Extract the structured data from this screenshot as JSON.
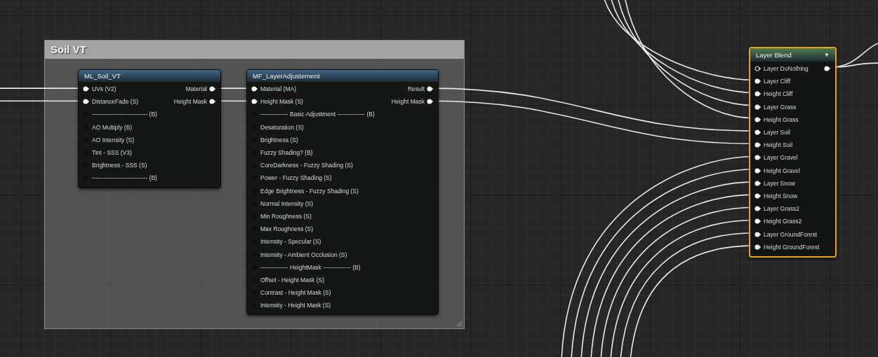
{
  "comment": {
    "title": "Soil VT"
  },
  "nodes": [
    {
      "title": "ML_Soil_VT",
      "color": "#3f6688",
      "selected": false,
      "inputs": [
        {
          "label": "UVs (V2)",
          "connected": true
        },
        {
          "label": "DistanceFade (S)",
          "connected": true
        },
        {
          "label": "---------------------------- (B)",
          "connected": false
        },
        {
          "label": "AO Multiply (B)",
          "connected": false
        },
        {
          "label": "AO Intensity (S)",
          "connected": false
        },
        {
          "label": "Tint - SSS (V3)",
          "connected": false
        },
        {
          "label": "Brightness - SSS (S)",
          "connected": false
        },
        {
          "label": "---------------------------- (B)",
          "connected": false
        }
      ],
      "outputs": [
        {
          "label": "Material",
          "connected": true
        },
        {
          "label": "Height Mask",
          "connected": true
        }
      ]
    },
    {
      "title": "MF_LayerAdjustement",
      "color": "#3f6688",
      "selected": false,
      "inputs": [
        {
          "label": "Material (MA)",
          "connected": true
        },
        {
          "label": "Height Mask (S)",
          "connected": true
        },
        {
          "label": "-------------- Basic Adjustment -------------- (B)",
          "connected": false
        },
        {
          "label": "Desaturation (S)",
          "connected": false
        },
        {
          "label": "Brightness (S)",
          "connected": false
        },
        {
          "label": "Fuzzy Shading? (B)",
          "connected": false
        },
        {
          "label": "CoreDarkness - Fuzzy Shading (S)",
          "connected": false
        },
        {
          "label": "Power - Fuzzy Shading (S)",
          "connected": false
        },
        {
          "label": "Edge Brightness - Fuzzy Shading (S)",
          "connected": false
        },
        {
          "label": "Normal Intensity (S)",
          "connected": false
        },
        {
          "label": "Min Roughness (S)",
          "connected": false
        },
        {
          "label": "Max Roughness (S)",
          "connected": false
        },
        {
          "label": "Intensity - Specular (S)",
          "connected": false
        },
        {
          "label": "Intensity - Ambient Occlusion (S)",
          "connected": false
        },
        {
          "label": "-------------- HeightMask -------------- (B)",
          "connected": false
        },
        {
          "label": "Offset - Height Mask (S)",
          "connected": false
        },
        {
          "label": "Contrast - Height Mask (S)",
          "connected": false
        },
        {
          "label": "Intensity - Height Mask (S)",
          "connected": false
        }
      ],
      "outputs": [
        {
          "label": "Result",
          "connected": true
        },
        {
          "label": "Height Mask",
          "connected": true
        }
      ]
    },
    {
      "title": "Layer Blend",
      "color": "#4f7a4f",
      "selected": true,
      "menu_glyph": "▼",
      "inputs": [
        {
          "label": "Layer DoNothing",
          "connected": false
        },
        {
          "label": "Layer Cliff",
          "connected": true
        },
        {
          "label": "Height Cliff",
          "connected": true
        },
        {
          "label": "Layer Grass",
          "connected": true
        },
        {
          "label": "Height Grass",
          "connected": true
        },
        {
          "label": "Layer Soil",
          "connected": true
        },
        {
          "label": "Height Soil",
          "connected": true
        },
        {
          "label": "Layer Gravel",
          "connected": true
        },
        {
          "label": "Height Gravel",
          "connected": true
        },
        {
          "label": "Layer Snow",
          "connected": true
        },
        {
          "label": "Height Snow",
          "connected": true
        },
        {
          "label": "Layer Grass2",
          "connected": true
        },
        {
          "label": "Height Grass2",
          "connected": true
        },
        {
          "label": "Layer GroundForest",
          "connected": true
        },
        {
          "label": "Height GroundForest",
          "connected": true
        }
      ],
      "outputs": [
        {
          "connected": true
        }
      ]
    }
  ]
}
